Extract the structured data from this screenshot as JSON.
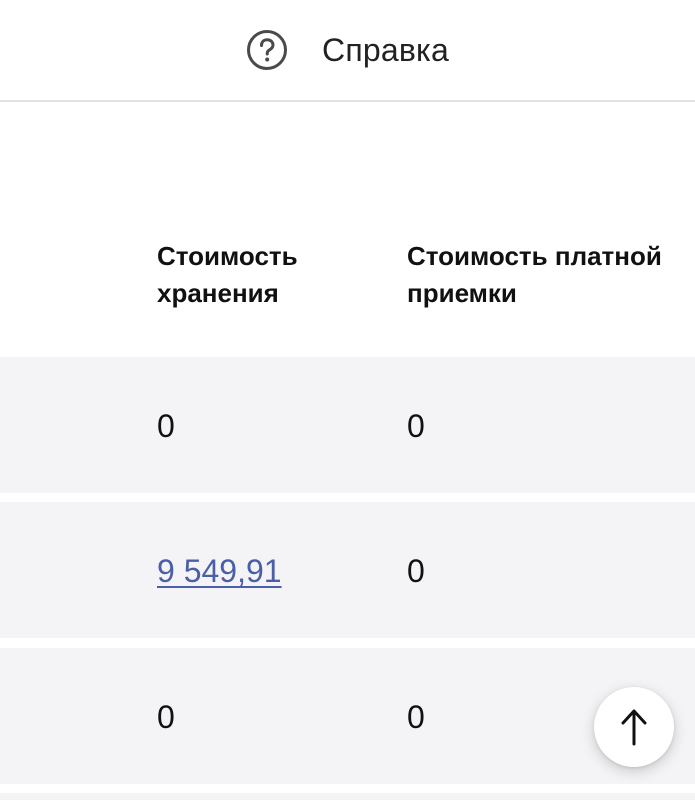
{
  "header": {
    "help_label": "Справка",
    "help_icon": "help-circle-icon"
  },
  "table": {
    "columns": [
      "Стоимость хранения",
      "Стоимость платной приемки"
    ],
    "rows": [
      [
        "0",
        "0"
      ],
      [
        "9 549,91",
        "0"
      ],
      [
        "0",
        "0"
      ]
    ]
  },
  "scroll_top": {
    "icon": "arrow-up-icon"
  },
  "colors": {
    "link": "#4a5fa8",
    "row_background": "#f4f4f6",
    "divider": "#e2e2e5"
  }
}
